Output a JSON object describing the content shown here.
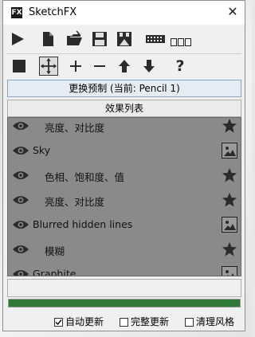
{
  "window": {
    "title": "SketchFX",
    "icon_letters": "FX"
  },
  "toolbar1": {
    "buttons": [
      "play-icon",
      "document-icon",
      "open-folder-icon",
      "save-icon",
      "save-as-icon",
      "film-strip-icon",
      "frames-icon"
    ]
  },
  "toolbar2": {
    "buttons": [
      "stop-square-icon",
      "move-icon",
      "plus-icon",
      "minus-icon",
      "arrow-up-icon",
      "arrow-down-icon",
      "help-icon"
    ],
    "help_label": "?"
  },
  "preset_button": "更换预制 (当前: Pencil 1)",
  "effects_tab": "效果列表",
  "effects": [
    {
      "label": "亮度、对比度",
      "indent": true,
      "icon": "star-icon"
    },
    {
      "label": "Sky",
      "indent": false,
      "icon": "image-icon"
    },
    {
      "label": "色相、饱和度、值",
      "indent": true,
      "icon": "star-icon"
    },
    {
      "label": "亮度、对比度",
      "indent": true,
      "icon": "star-icon"
    },
    {
      "label": "Blurred hidden lines",
      "indent": false,
      "icon": "image-icon"
    },
    {
      "label": "模糊",
      "indent": true,
      "icon": "star-icon"
    },
    {
      "label": "Graphite",
      "indent": false,
      "icon": "image-icon"
    }
  ],
  "progress": {
    "percent": 100,
    "color": "#2f7a35"
  },
  "options": {
    "auto_update": {
      "label": "自动更新",
      "checked": true
    },
    "full_update": {
      "label": "完整更新",
      "checked": false
    },
    "clean_style": {
      "label": "清理风格",
      "checked": false
    }
  },
  "colors": {
    "list_bg": "#8a8a8a",
    "accent": "#2f7a35"
  }
}
